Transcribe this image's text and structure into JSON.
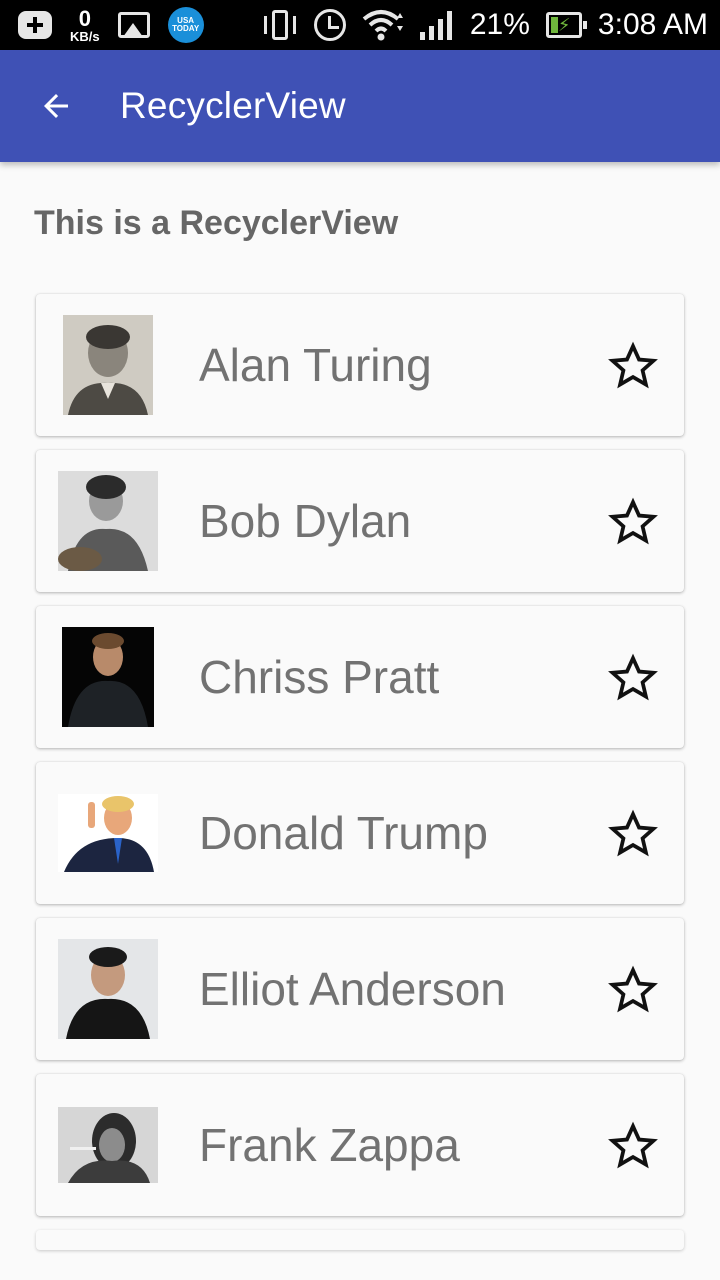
{
  "status_bar": {
    "speed_value": "0",
    "speed_unit": "KB/s",
    "usa_today_line1": "USA",
    "usa_today_line2": "TODAY",
    "battery_percent": "21%",
    "time": "3:08 AM"
  },
  "app_bar": {
    "title": "RecyclerView",
    "background_color": "#3f51b5"
  },
  "main": {
    "heading": "This is a RecyclerView",
    "items": [
      {
        "name": "Alan Turing",
        "photo": "photo-grayscale"
      },
      {
        "name": "Bob Dylan",
        "photo": "photo-grayscale"
      },
      {
        "name": "Chriss Pratt",
        "photo": "photo-dark"
      },
      {
        "name": "Donald Trump",
        "photo": "photo-white-bg"
      },
      {
        "name": "Elliot Anderson",
        "photo": "photo-light"
      },
      {
        "name": "Frank Zappa",
        "photo": "photo-grayscale"
      }
    ]
  }
}
